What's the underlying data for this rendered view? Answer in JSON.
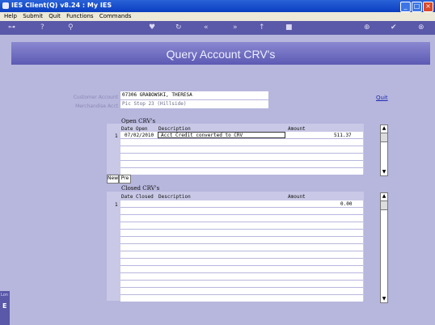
{
  "window": {
    "title": "IES Client(Q) v8.24 : My IES"
  },
  "menu": {
    "items": [
      "Help",
      "Submit",
      "Quit",
      "Functions",
      "Commands"
    ]
  },
  "page": {
    "title": "Query Account CRV's",
    "quit_label": "Quit"
  },
  "form": {
    "customer_account_label": "Customer Account",
    "customer_account_value": "07306 GRABOWSKI, THERESA",
    "merchandise_acct_label": "Merchandise Acct",
    "merchandise_acct_value": "Pic Stop 23 (Hillside)"
  },
  "open_crvs": {
    "heading": "Open CRV's",
    "columns": {
      "date": "Date Open",
      "description": "Description",
      "amount": "Amount"
    },
    "rows": [
      {
        "num": "1",
        "date": "07/02/2010",
        "description": "Acct Credit converted to CRV",
        "amount": "511.37"
      }
    ]
  },
  "nav": {
    "new_label": "New",
    "prev_label": "Pre"
  },
  "closed_crvs": {
    "heading": "Closed CRV's",
    "columns": {
      "date": "Date Closed",
      "description": "Description",
      "amount": "Amount"
    },
    "rows": [
      {
        "num": "1",
        "date": "",
        "description": "",
        "amount": "0.00"
      }
    ]
  },
  "sidebar": {
    "label": "Lon",
    "icon": "E"
  }
}
